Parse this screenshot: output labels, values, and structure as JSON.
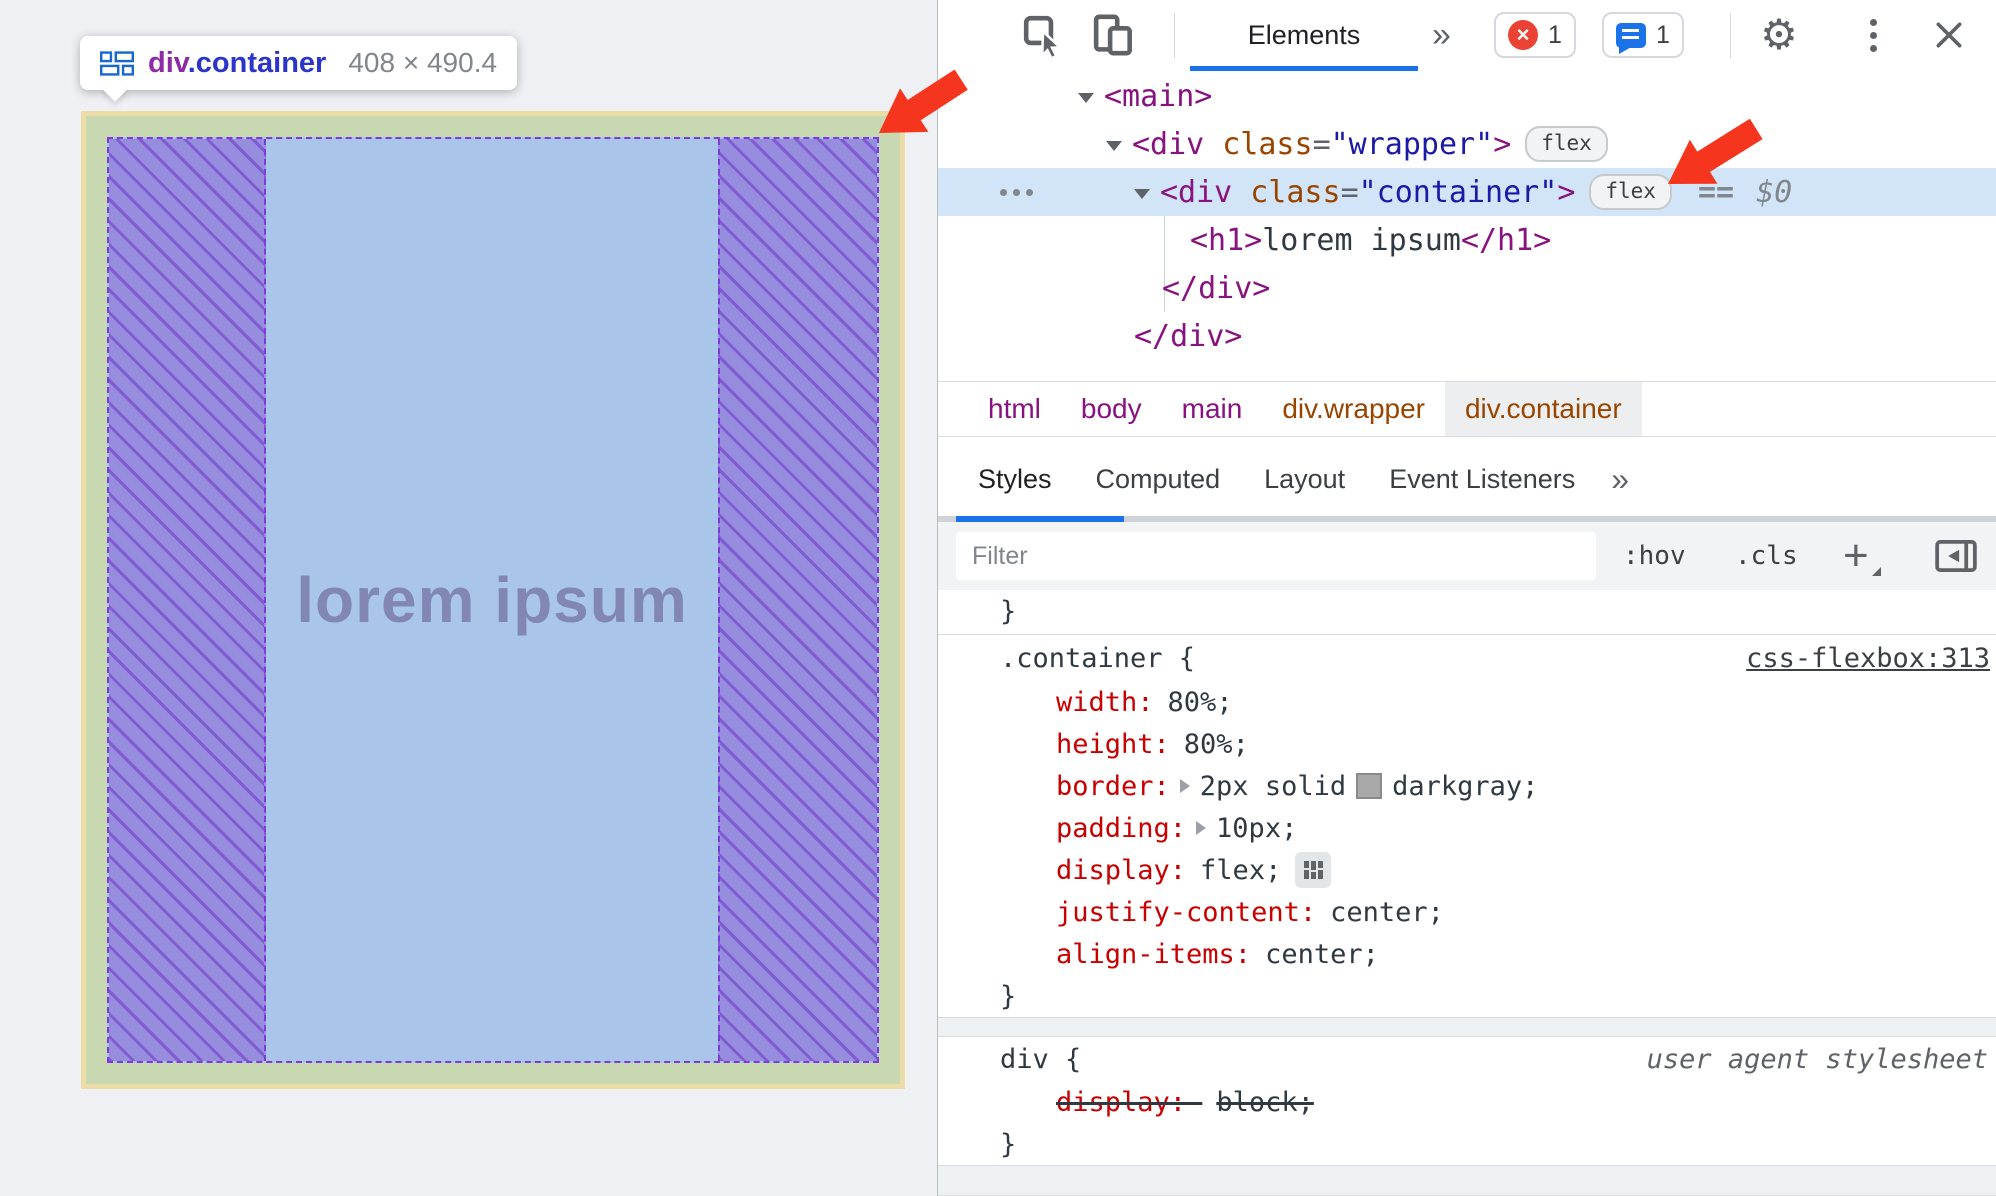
{
  "page": {
    "tooltip": {
      "tag": "div",
      "cls": ".container",
      "size": "408 × 490.4"
    },
    "heading": "lorem ipsum"
  },
  "devtools": {
    "toolbar": {
      "tab": "Elements",
      "more": "»",
      "error_count": "1",
      "issues_count": "1"
    },
    "tree": {
      "r0": {
        "tag": "<main>"
      },
      "r1": {
        "open": "<div",
        "attr": "class",
        "eq": "=",
        "val": "\"wrapper\"",
        "close": ">",
        "badge": "flex"
      },
      "r2": {
        "open": "<div",
        "attr": "class",
        "eq": "=",
        "val": "\"container\"",
        "close": ">",
        "badge": "flex",
        "equals": "==",
        "dollar": "$0"
      },
      "r3": {
        "open": "<h1>",
        "text": "lorem ipsum",
        "close": "</h1>"
      },
      "r4": {
        "tag": "</div>"
      },
      "r5": {
        "tag": "</div>"
      }
    },
    "crumbs": [
      {
        "label": "html"
      },
      {
        "label": "body"
      },
      {
        "label": "main"
      },
      {
        "label": "div.wrapper"
      },
      {
        "label": "div.container"
      }
    ],
    "tabs": [
      {
        "label": "Styles"
      },
      {
        "label": "Computed"
      },
      {
        "label": "Layout"
      },
      {
        "label": "Event Listeners"
      }
    ],
    "tabs_more": "»",
    "filter": {
      "placeholder": "Filter",
      "hov": ":hov",
      "cls": ".cls",
      "add": "+"
    },
    "styles": {
      "prev_close": "}",
      "rule1": {
        "selector": ".container {",
        "link": "css-flexbox:313",
        "p0": {
          "name": "width:",
          "value": "80%;"
        },
        "p1": {
          "name": "height:",
          "value": "80%;"
        },
        "p2": {
          "name": "border:",
          "value_a": "2px solid",
          "value_b": "darkgray;"
        },
        "p3": {
          "name": "padding:",
          "value": "10px;"
        },
        "p4": {
          "name": "display:",
          "value": "flex;"
        },
        "p5": {
          "name": "justify-content:",
          "value": "center;"
        },
        "p6": {
          "name": "align-items:",
          "value": "center;"
        },
        "close": "}"
      },
      "rule2": {
        "selector": "div {",
        "origin": "user agent stylesheet",
        "p0": {
          "name": "display:",
          "value": "block;"
        },
        "close": "}"
      }
    }
  },
  "colors": {
    "accent": "#1a73e8",
    "tag": "#881280",
    "attr": "#994500",
    "attr_value": "#1a1aa6",
    "property": "#c80000",
    "error": "#ea4335",
    "overlay_content": "#a9c6ea",
    "overlay_free_space": "#968dde",
    "overlay_padding": "#c8d9b2",
    "overlay_border": "#ecdca6",
    "arrow": "#f5351d"
  }
}
